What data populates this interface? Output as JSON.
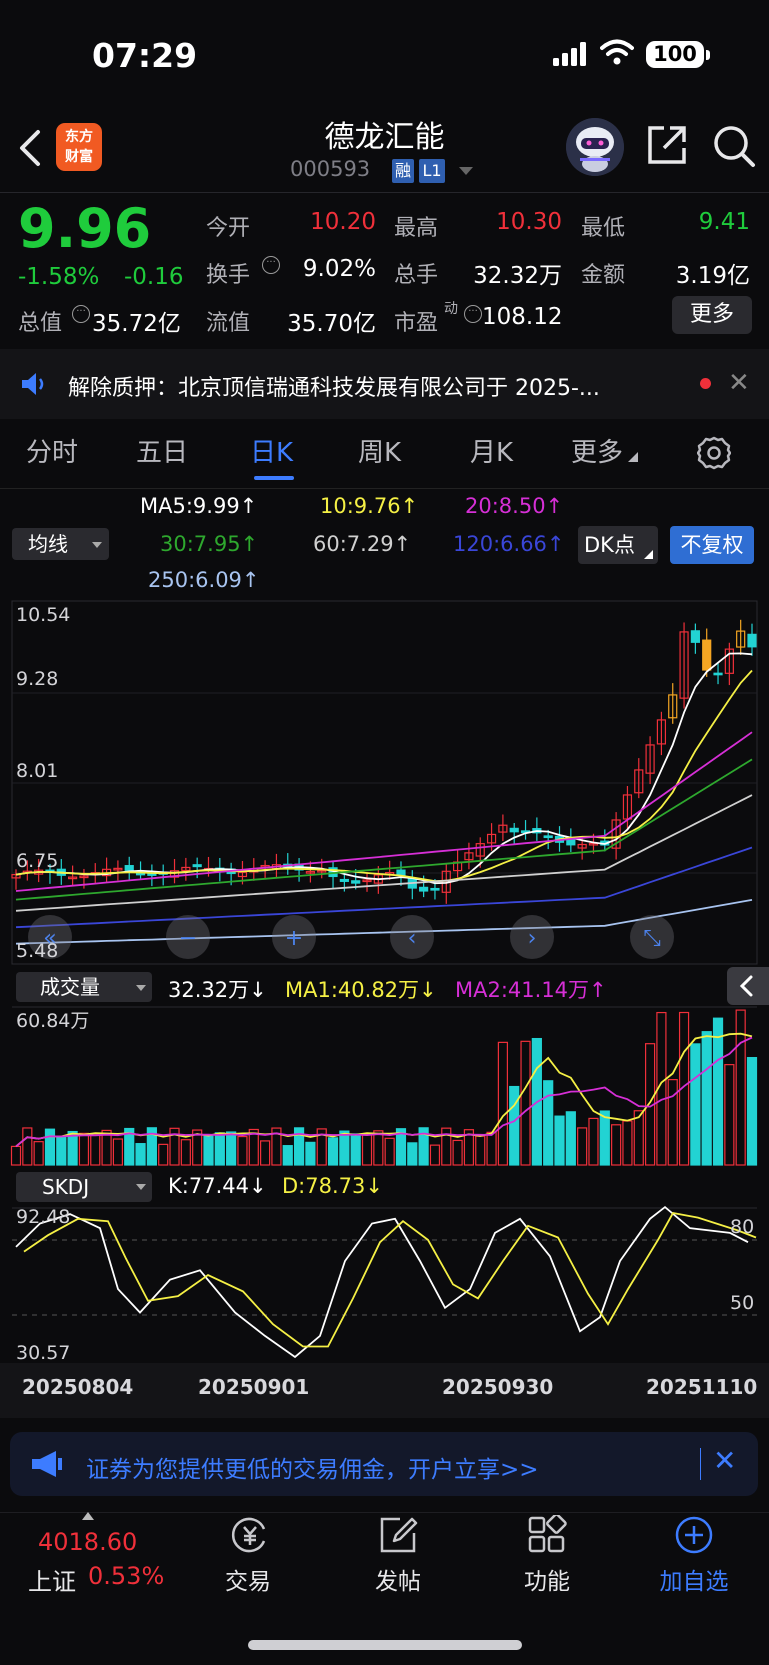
{
  "status": {
    "time": "07:29",
    "battery": "100"
  },
  "header": {
    "logo_line1": "东方",
    "logo_line2": "财富",
    "name": "德龙汇能",
    "code": "000593",
    "badge_rong": "融",
    "badge_l1": "L1"
  },
  "quote": {
    "price": "9.96",
    "change_pct": "-1.58%",
    "change_amt": "-0.16",
    "open_label": "今开",
    "open": "10.20",
    "high_label": "最高",
    "high": "10.30",
    "low_label": "最低",
    "low": "9.41",
    "turnover_label": "换手",
    "turnover": "9.02%",
    "volume_label": "总手",
    "volume": "32.32万",
    "amount_label": "金额",
    "amount": "3.19亿",
    "mktcap_label": "总值",
    "mktcap": "35.72亿",
    "float_label": "流值",
    "float": "35.70亿",
    "pe_label": "市盈",
    "pe_sup": "动",
    "pe": "108.12",
    "more": "更多"
  },
  "news": {
    "text": "解除质押：北京顶信瑞通科技发展有限公司于 2025-..."
  },
  "tabs": [
    "分时",
    "五日",
    "日K",
    "周K",
    "月K",
    "更多"
  ],
  "ma_legend": {
    "select": "均线",
    "ma5": "MA5:9.99↑",
    "ma10": "10:9.76↑",
    "ma20": "20:8.50↑",
    "ma30": "30:7.95↑",
    "ma60": "60:7.29↑",
    "ma120": "120:6.66↑",
    "ma250": "250:6.09↑",
    "dk": "DK点",
    "fq": "不复权"
  },
  "colors": {
    "up": "#f0303a",
    "down": "#22d3d3",
    "ma5": "#ffffff",
    "ma10": "#f5f045",
    "ma20": "#d62fd6",
    "ma30": "#2ea82e",
    "ma60": "#d0d0d0",
    "ma120": "#3a46d8",
    "ma250": "#a8c4f0",
    "accent": "#3d7cff"
  },
  "volume_legend": {
    "select": "成交量",
    "vol": "32.32万↓",
    "ma1": "MA1:40.82万↓",
    "ma2": "MA2:41.14万↑"
  },
  "skdj_legend": {
    "select": "SKDJ",
    "k": "K:77.44↓",
    "d": "D:78.73↓"
  },
  "chart_data": {
    "type": "candlestick",
    "price_axis": [
      "10.54",
      "9.28",
      "8.01",
      "6.75",
      "5.48"
    ],
    "volume_axis_max": "60.84万",
    "skdj_axis": {
      "max": "92.48",
      "min": "30.57",
      "ref_high": "80",
      "ref_low": "50"
    },
    "dates": [
      "20250804",
      "20250901",
      "20250930",
      "20251110"
    ]
  },
  "promo": {
    "text": "证券为您提供更低的交易佣金，开户立享>>"
  },
  "nav": {
    "index_value": "4018.60",
    "index_name": "上证",
    "index_pct": "0.53%",
    "trade": "交易",
    "post": "发帖",
    "func": "功能",
    "watch": "加自选"
  }
}
